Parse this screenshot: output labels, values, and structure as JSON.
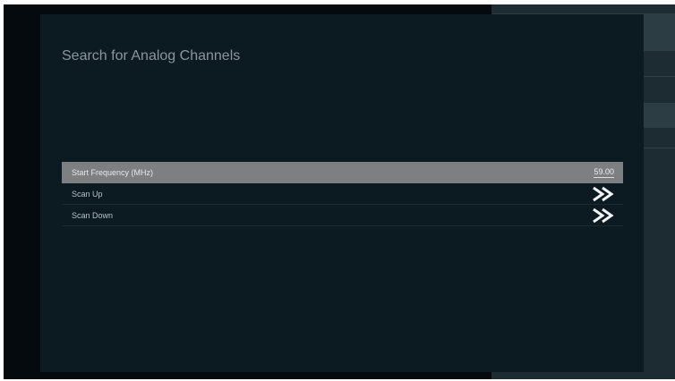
{
  "dialog": {
    "title": "Search for Analog Channels"
  },
  "menu": {
    "items": [
      {
        "label": "Start Frequency (MHz)",
        "value": "59.00"
      },
      {
        "label": "Scan Up",
        "icon": "double-chevron-right-icon"
      },
      {
        "label": "Scan Down",
        "icon": "double-chevron-right-icon"
      }
    ]
  },
  "colors": {
    "dialog_background": "#0c1a21",
    "selected_row": "#7d7f81",
    "frame_background": "#050a0e",
    "right_panel": "#1c2c32"
  }
}
